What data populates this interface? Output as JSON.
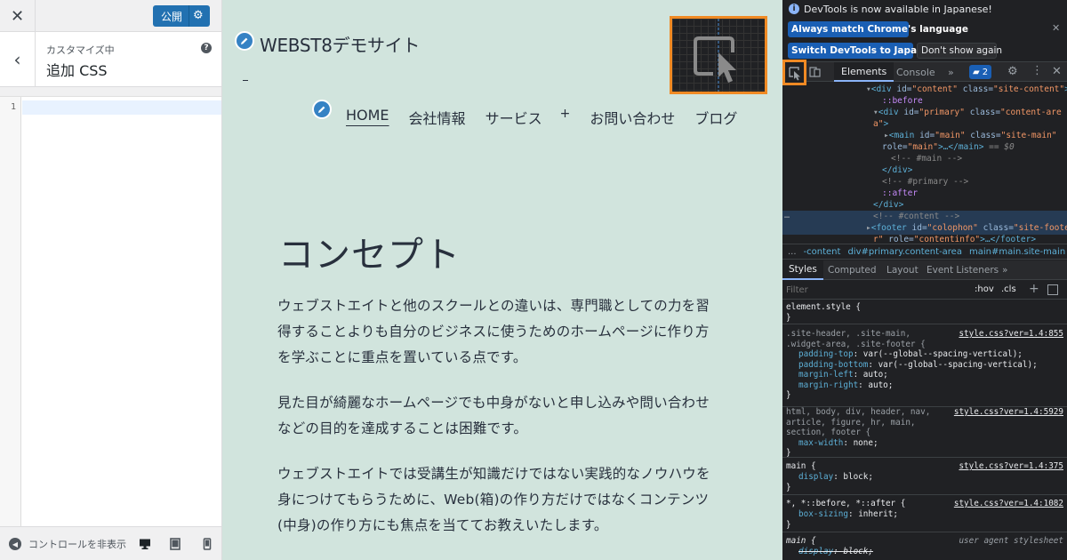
{
  "customizer": {
    "close_label": "✕",
    "publish_label": "公開",
    "breadcrumb": "カスタマイズ中",
    "section_title": "追加 CSS",
    "help_label": "?",
    "line_number": "1",
    "hide_controls_label": "コントロールを非表示"
  },
  "preview": {
    "site_title": "WEBST8デモサイト",
    "nav": [
      "HOME",
      "会社情報",
      "サービス",
      "+",
      "お問い合わせ",
      "ブログ"
    ],
    "page_heading": "コンセプト",
    "paragraphs": [
      "ウェブストエイトと他のスクールとの違いは、専門職としての力を習得することよりも自分のビジネスに使うためのホームページに作り方を学ぶことに重点を置いている点です。",
      "見た目が綺麗なホームページでも中身がないと申し込みや問い合わせなどの目的を達成することは困難です。",
      "ウェブストエイトでは受講生が知識だけではない実践的なノウハウを身につけてもらうために、Web(箱)の作り方だけではなくコンテンツ(中身)の作り方にも焦点を当ててお教えいたします。"
    ]
  },
  "devtools": {
    "info_text": "DevTools is now available in Japanese!",
    "btn_match": "Always match Chrome's language",
    "btn_switch": "Switch DevTools to Japanese",
    "btn_dontshow": "Don't show again",
    "tabs": {
      "elements": "Elements",
      "console": "Console",
      "more": "»"
    },
    "message_count": "2",
    "dom": {
      "l1_tag": "<div",
      "l1_attr1": " id=",
      "l1_val1": "\"content\"",
      "l1_attr2": " class=",
      "l1_val2": "\"site-content\"",
      "l1_end": ">",
      "l2": "::before",
      "l3_tag": "<div",
      "l3_attr1": " id=",
      "l3_val1": "\"primary\"",
      "l3_attr2": " class=",
      "l3_val2": "\"content-are",
      "l4_val": "a\"",
      "l4_end": ">",
      "l5_tag": "<main",
      "l5_attr1": " id=",
      "l5_val1": "\"main\"",
      "l5_attr2": " class=",
      "l5_val2": "\"site-main\"",
      "l6_attr": "role=",
      "l6_val": "\"main\"",
      "l6_rest": ">…</main>",
      "l6_eq": " == $0",
      "l7": "<!-- #main -->",
      "l8": "</div>",
      "l9": "<!-- #primary -->",
      "l10": "::after",
      "l11": "</div>",
      "l12": "<!-- #content -->",
      "l13_tag": "<footer",
      "l13_attr1": " id=",
      "l13_val1": "\"colophon\"",
      "l13_attr2": " class=",
      "l13_val2": "\"site-foote",
      "l14_val": "r\"",
      "l14_attr": " role=",
      "l14_val2": "\"contentinfo\"",
      "l14_rest": ">…</footer>"
    },
    "breadcrumbs": [
      "...",
      "-content",
      "div#primary.content-area",
      "main#main.site-main"
    ],
    "styles_tabs": {
      "styles": "Styles",
      "computed": "Computed",
      "layout": "Layout",
      "events": "Event Listeners",
      "more": "»"
    },
    "filter_placeholder": "Filter",
    "filter_hov": ":hov",
    "filter_cls": ".cls",
    "rules": {
      "r1_sel": "element.style {",
      "r1_end": "}",
      "r2_sel1": ".site-header, .site-main,",
      "r2_sel2": ".widget-area, .site-footer {",
      "r2_src": "style.css?ver=1.4:855",
      "r2_p1": "padding-top",
      "r2_v1": "var(--global--spacing-vertical);",
      "r2_p2": "padding-bottom",
      "r2_v2": "var(--global--spacing-vertical);",
      "r2_p3": "margin-left",
      "r2_v3": "auto;",
      "r2_p4": "margin-right",
      "r2_v4": "auto;",
      "r2_end": "}",
      "r3_sel1": "html, body, div, header, nav,",
      "r3_sel2": "article, figure, hr, main,",
      "r3_sel3": "section, footer {",
      "r3_src": "style.css?ver=1.4:5929",
      "r3_p1": "max-width",
      "r3_v1": "none;",
      "r3_end": "}",
      "r4_sel": "main {",
      "r4_src": "style.css?ver=1.4:375",
      "r4_p1": "display",
      "r4_v1": "block;",
      "r4_end": "}",
      "r5_sel": "*, *::before, *::after {",
      "r5_src": "style.css?ver=1.4:1082",
      "r5_p1": "box-sizing",
      "r5_v1": "inherit;",
      "r5_end": "}",
      "r6_sel": "main {",
      "r6_src": "user agent stylesheet",
      "r6_p1": "display",
      "r6_v1": "block;"
    }
  },
  "colors": {
    "preview_bg": "#d1e4dd",
    "publish_blue": "#2271b1",
    "highlight_orange": "#f08a24",
    "devtools_bg": "#202124"
  }
}
